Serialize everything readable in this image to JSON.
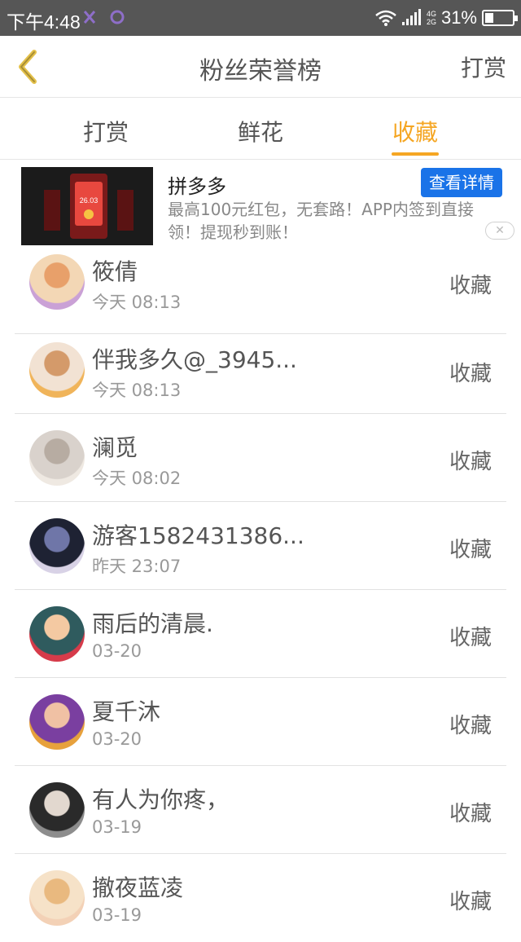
{
  "status_bar": {
    "time": "下午4:48",
    "network_top": "4G",
    "network_bottom": "2G",
    "battery": "31%",
    "battery_level": 0.31
  },
  "header": {
    "title": "粉丝荣誉榜",
    "action": "打赏"
  },
  "tabs": [
    {
      "label": "打赏",
      "active": false
    },
    {
      "label": "鲜花",
      "active": false
    },
    {
      "label": "收藏",
      "active": true
    }
  ],
  "ad": {
    "name": "拼多多",
    "cta": "查看详情",
    "description": "最高100元红包，无套路！APP内签到直接领！提现秒到账！",
    "thumb_amount": "26.03"
  },
  "fans": [
    {
      "name": "筱倩",
      "time": "今天 08:13",
      "kind": "收藏",
      "avatar_colors": [
        "#f3d7b5",
        "#e8a06a",
        "#caa1d6"
      ]
    },
    {
      "name": "伴我多久@_3945...",
      "time": "今天 08:13",
      "kind": "收藏",
      "avatar_colors": [
        "#f2e2d3",
        "#d49a6a",
        "#f0b45a"
      ]
    },
    {
      "name": "澜觅",
      "time": "今天 08:02",
      "kind": "收藏",
      "avatar_colors": [
        "#d9d2cc",
        "#b7aca2",
        "#efe9e2"
      ]
    },
    {
      "name": "游客1582431386...",
      "time": "昨天 23:07",
      "kind": "收藏",
      "avatar_colors": [
        "#1e2233",
        "#6f76a8",
        "#d8d2e6"
      ]
    },
    {
      "name": "雨后的清晨.",
      "time": "03-20",
      "kind": "收藏",
      "avatar_colors": [
        "#2f5b5e",
        "#f4c9a2",
        "#d63b4a"
      ]
    },
    {
      "name": "夏千沐",
      "time": "03-20",
      "kind": "收藏",
      "avatar_colors": [
        "#7a3fa0",
        "#f0c1a4",
        "#e7a13c"
      ]
    },
    {
      "name": "有人为你疼，",
      "time": "03-19",
      "kind": "收藏",
      "avatar_colors": [
        "#2a2a2a",
        "#e2d8cf",
        "#8d8d8d"
      ]
    },
    {
      "name": "撤夜蓝凌",
      "time": "03-19",
      "kind": "收藏",
      "avatar_colors": [
        "#f6e2c8",
        "#e9b97f",
        "#f3d1b6"
      ]
    }
  ]
}
